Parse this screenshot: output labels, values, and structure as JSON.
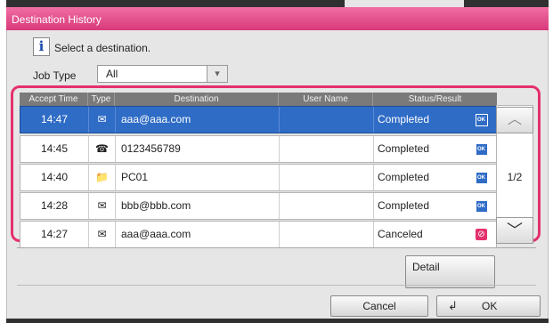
{
  "window": {
    "title": "Destination History"
  },
  "prompt": {
    "icon": "info-icon",
    "text": "Select a destination."
  },
  "job_type": {
    "label": "Job Type",
    "value": "All"
  },
  "table": {
    "columns": [
      "Accept Time",
      "Type",
      "Destination",
      "User Name",
      "Status/Result"
    ],
    "rows": [
      {
        "time": "14:47",
        "type_icon": "email-icon",
        "type_glyph": "✉",
        "destination": "aaa@aaa.com",
        "user": "",
        "status": "Completed",
        "status_icon": "ok-icon",
        "status_glyph": "OK",
        "selected": true
      },
      {
        "time": "14:45",
        "type_icon": "fax-icon",
        "type_glyph": "☎",
        "destination": "0123456789",
        "user": "",
        "status": "Completed",
        "status_icon": "ok-icon",
        "status_glyph": "OK",
        "selected": false
      },
      {
        "time": "14:40",
        "type_icon": "folder-icon",
        "type_glyph": "📁",
        "destination": "PC01",
        "user": "",
        "status": "Completed",
        "status_icon": "ok-icon",
        "status_glyph": "OK",
        "selected": false
      },
      {
        "time": "14:28",
        "type_icon": "email-icon",
        "type_glyph": "✉",
        "destination": "bbb@bbb.com",
        "user": "",
        "status": "Completed",
        "status_icon": "ok-icon",
        "status_glyph": "OK",
        "selected": false
      },
      {
        "time": "14:27",
        "type_icon": "email-icon",
        "type_glyph": "✉",
        "destination": "aaa@aaa.com",
        "user": "",
        "status": "Canceled",
        "status_icon": "canceled-icon",
        "status_glyph": "⊘",
        "selected": false
      }
    ]
  },
  "pager": {
    "up_glyph": "︿",
    "down_glyph": "﹀",
    "page": "1/2"
  },
  "buttons": {
    "detail": "Detail",
    "cancel": "Cancel",
    "ok": "OK",
    "ok_glyph": "↲"
  },
  "colors": {
    "accent": "#e4306e",
    "title_bar": "#e0458a",
    "selected_row": "#2f6cc6"
  }
}
